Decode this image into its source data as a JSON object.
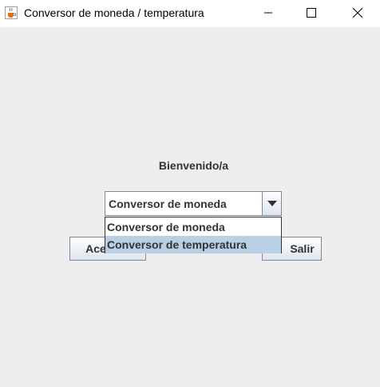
{
  "window": {
    "title": "Conversor de moneda / temperatura",
    "app_icon": "java-cup-icon",
    "controls": [
      "minimize-icon",
      "maximize-icon",
      "close-icon"
    ]
  },
  "main": {
    "welcome_label": "Bienvenido/a",
    "combo": {
      "selected": "Conversor de moneda",
      "options": [
        "Conversor de moneda",
        "Conversor de temperatura"
      ],
      "highlighted": "Conversor de temperatura",
      "arrow_icon": "triangle-down-icon"
    },
    "accept_button_visible": "Ace",
    "exit_button": "Salir"
  },
  "colors": {
    "background": "#eeeeee",
    "highlight": "#b8cfe5",
    "border": "#7a8a99"
  }
}
